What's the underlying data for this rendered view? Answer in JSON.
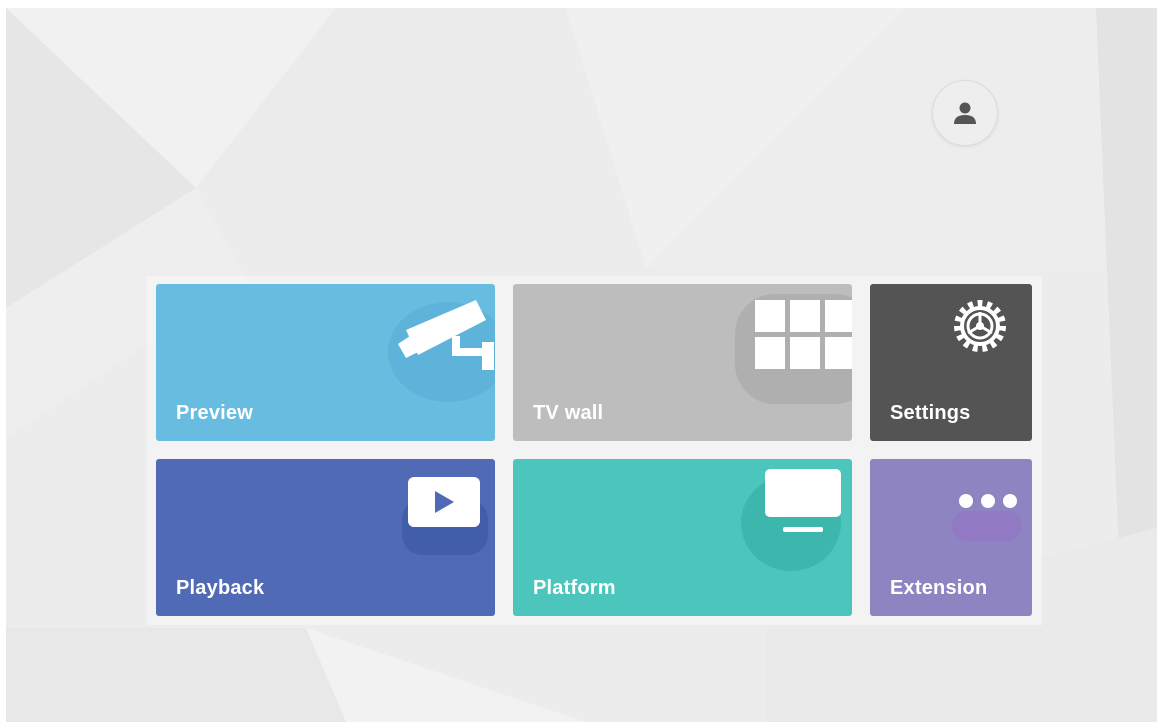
{
  "user": {
    "icon": "user-icon"
  },
  "tiles": {
    "preview": {
      "label": "Preview",
      "color": "#68bcdf",
      "icon": "camera-icon"
    },
    "tvwall": {
      "label": "TV wall",
      "color": "#bdbdbd",
      "icon": "grid-icon"
    },
    "settings": {
      "label": "Settings",
      "color": "#545454",
      "icon": "gear-icon"
    },
    "playback": {
      "label": "Playback",
      "color": "#516ab6",
      "icon": "play-icon"
    },
    "platform": {
      "label": "Platform",
      "color": "#4cc6bd",
      "icon": "monitor-icon"
    },
    "extension": {
      "label": "Extension",
      "color": "#8d84c1",
      "icon": "more-icon"
    }
  }
}
